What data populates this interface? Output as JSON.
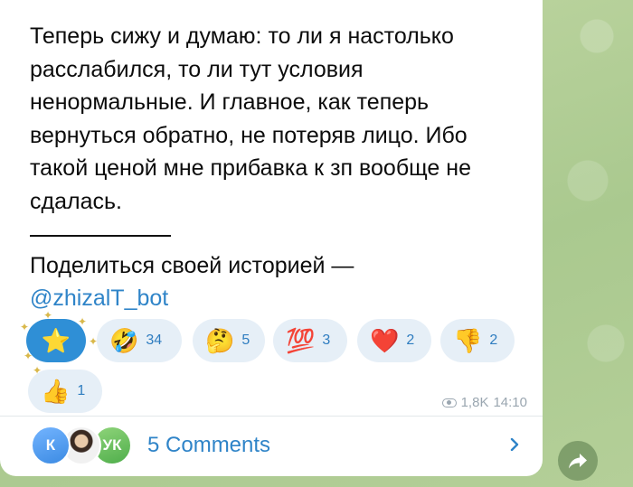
{
  "message": {
    "text": "Теперь сижу и думаю: то ли я настолько\nрасслабился, то ли тут условия\nненормальные. И главное, как теперь\nвернуться обратно, не потеряв лицо. Ибо\nтакой ценой мне прибавка к зп вообще не\nсдалась.",
    "share_line": "Поделиться своей историей —",
    "share_link": "@zhizalT_bot"
  },
  "reactions": [
    {
      "emoji": "⭐",
      "count": "",
      "icon": "star-icon"
    },
    {
      "emoji": "🤣",
      "count": "34",
      "icon": "rofl-icon"
    },
    {
      "emoji": "🤔",
      "count": "5",
      "icon": "thinking-icon"
    },
    {
      "emoji": "💯",
      "count": "3",
      "icon": "hundred-icon"
    },
    {
      "emoji": "❤️",
      "count": "2",
      "icon": "heart-icon"
    },
    {
      "emoji": "👎",
      "count": "2",
      "icon": "thumbs-down-icon"
    },
    {
      "emoji": "👍",
      "count": "1",
      "icon": "thumbs-up-icon"
    }
  ],
  "meta": {
    "views": "1,8K",
    "time": "14:10"
  },
  "comments": {
    "avatars": [
      "К",
      "",
      "УК"
    ],
    "label": "5 Comments"
  },
  "colors": {
    "link": "#2f84c8",
    "reaction_bg": "#e6eff7",
    "chat_bg": "#b7cf9c"
  }
}
